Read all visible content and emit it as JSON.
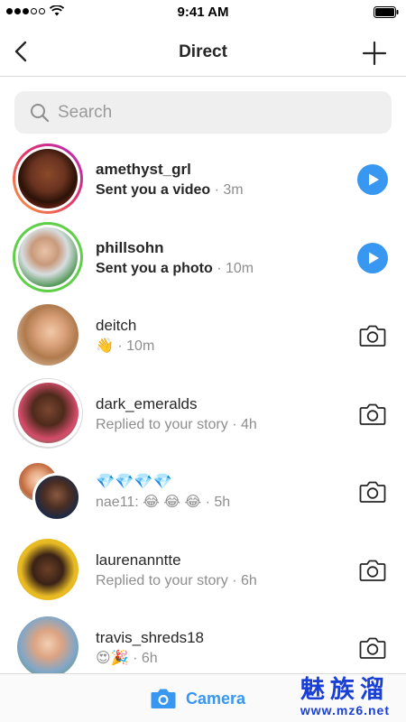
{
  "status_bar": {
    "time": "9:41 AM",
    "signal_icon": "signal-dots-icon",
    "wifi_icon": "wifi-icon",
    "battery_icon": "battery-icon"
  },
  "header": {
    "title": "Direct",
    "back_icon": "chevron-left-icon",
    "new_icon": "plus-icon"
  },
  "search": {
    "placeholder": "Search",
    "icon": "search-icon"
  },
  "threads": [
    {
      "username": "amethyst_grl",
      "preview": "Sent you a video",
      "time": "· 3m",
      "unread": true,
      "action": "play-icon"
    },
    {
      "username": "phillsohn",
      "preview": "Sent you a photo",
      "time": "· 10m",
      "unread": true,
      "action": "play-icon"
    },
    {
      "username": "deitch",
      "preview": "👋",
      "time": "· 10m",
      "unread": false,
      "action": "camera-icon"
    },
    {
      "username": "dark_emeralds",
      "preview": "Replied to your story",
      "time": "· 4h",
      "unread": false,
      "action": "camera-icon"
    },
    {
      "username": "💎💎💎💎",
      "preview": "nae11: 😂 😂 😂",
      "time": "· 5h",
      "unread": false,
      "action": "camera-icon"
    },
    {
      "username": "laurenanntte",
      "preview": "Replied to your story",
      "time": "· 6h",
      "unread": false,
      "action": "camera-icon"
    },
    {
      "username": "travis_shreds18",
      "preview": "😍🎉",
      "time": "· 6h",
      "unread": false,
      "action": "camera-icon"
    }
  ],
  "bottom_bar": {
    "camera_label": "Camera",
    "camera_icon": "camera-icon"
  },
  "watermark": {
    "top": "魅族溜",
    "bottom": "www.mz6.net"
  },
  "colors": {
    "accent": "#3897f0",
    "story_ring_start": "#f9a23b",
    "story_ring_end": "#b02ac4",
    "close_friends_ring": "#5fcf48",
    "seen_ring": "#dbdbdb",
    "text_primary": "#262626",
    "text_secondary": "#8e8e8e"
  }
}
